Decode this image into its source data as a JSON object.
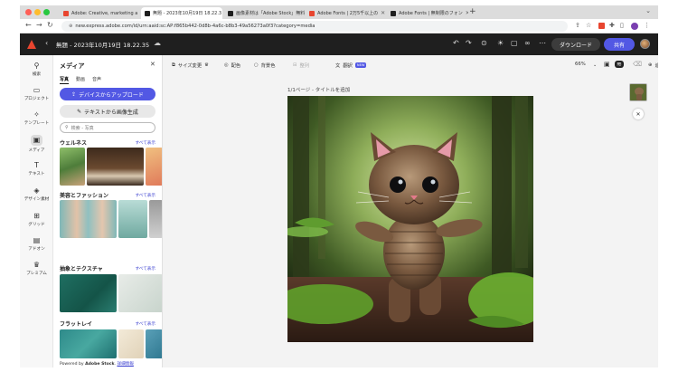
{
  "browser": {
    "tabs": [
      {
        "label": "Adobe: Creative, marketing a",
        "favicon_color": "#e8452f",
        "active": false
      },
      {
        "label": "無題 - 2023年10月19日 18.22.3",
        "favicon_color": "#1f1f1f",
        "active": true
      },
      {
        "label": "画像素材は「Adobe Stock」無料",
        "favicon_color": "#1f1f1f",
        "active": false
      },
      {
        "label": "Adobe Fonts | 2万5千以上の",
        "favicon_color": "#e8452f",
        "active": false
      },
      {
        "label": "Adobe Fonts | 無制限のフォン",
        "favicon_color": "#1f1f1f",
        "active": false
      }
    ],
    "url": "new.express.adobe.com/id/urn:aaid:sc:AP:f865b442-0d8b-4a6c-b8b3-49a56273a0f3?category=media"
  },
  "app": {
    "doc_title": "無題 - 2023年10月19日 18.22.35",
    "download_label": "ダウンロード",
    "share_label": "共有",
    "brand_color": "#5258e4"
  },
  "rail": {
    "items": [
      {
        "label": "検索",
        "icon": "search-icon",
        "glyph": "⚲"
      },
      {
        "label": "プロジェクト",
        "icon": "folder-icon",
        "glyph": "▭"
      },
      {
        "label": "テンプレート",
        "icon": "template-icon",
        "glyph": "✧"
      },
      {
        "label": "メディア",
        "icon": "media-icon",
        "glyph": "▣"
      },
      {
        "label": "テキスト",
        "icon": "text-icon",
        "glyph": "T"
      },
      {
        "label": "デザイン素材",
        "icon": "shapes-icon",
        "glyph": "◈"
      },
      {
        "label": "グリッド",
        "icon": "grid-icon",
        "glyph": "⊞"
      },
      {
        "label": "アドオン",
        "icon": "addons-icon",
        "glyph": "▤"
      },
      {
        "label": "プレミアム",
        "icon": "crown-icon",
        "glyph": "♛"
      }
    ]
  },
  "panel": {
    "title": "メディア",
    "tabs": [
      "写真",
      "動画",
      "音声"
    ],
    "upload_label": "デバイスからアップロード",
    "generate_label": "テキストから画像生成",
    "search_placeholder": "検索 - 写真",
    "see_all": "すべて表示",
    "categories": [
      "ウェルネス",
      "美容とファッション",
      "抽象とテクスチャ",
      "フラットレイ"
    ],
    "footer_prefix": "Powered by ",
    "footer_brand": "Adobe Stock",
    "footer_link": "詳細情報"
  },
  "toolbar": {
    "resize": "サイズ変更",
    "color": "配色",
    "bg_color": "背景色",
    "layout": "整列",
    "translate": "翻訳",
    "new_badge": "NEW",
    "zoom": "66%",
    "add": "追加"
  },
  "canvas": {
    "page_label": "1/1ページ - タイトルを追加"
  }
}
